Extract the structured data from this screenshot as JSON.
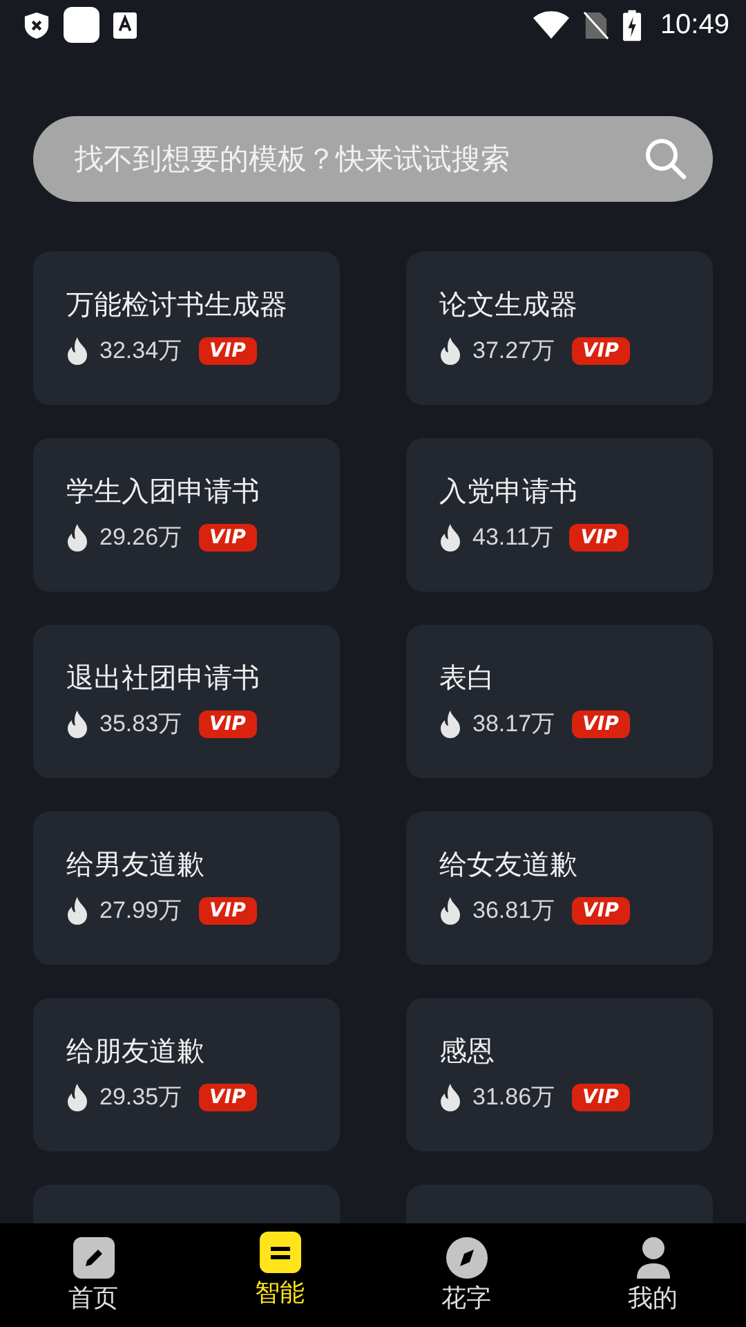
{
  "status_bar": {
    "time": "10:49"
  },
  "search": {
    "placeholder": "找不到想要的模板？快来试试搜索"
  },
  "templates": [
    {
      "kind": "template",
      "title": "万能检讨书生成器",
      "count": "32.34万",
      "badge": "VIP"
    },
    {
      "kind": "template",
      "title": "论文生成器",
      "count": "37.27万",
      "badge": "VIP"
    },
    {
      "kind": "template",
      "title": "学生入团申请书",
      "count": "29.26万",
      "badge": "VIP"
    },
    {
      "kind": "template",
      "title": "入党申请书",
      "count": "43.11万",
      "badge": "VIP"
    },
    {
      "kind": "template",
      "title": "退出社团申请书",
      "count": "35.83万",
      "badge": "VIP"
    },
    {
      "kind": "template",
      "title": "表白",
      "count": "38.17万",
      "badge": "VIP"
    },
    {
      "kind": "template",
      "title": "给男友道歉",
      "count": "27.99万",
      "badge": "VIP"
    },
    {
      "kind": "template",
      "title": "给女友道歉",
      "count": "36.81万",
      "badge": "VIP"
    },
    {
      "kind": "template",
      "title": "给朋友道歉",
      "count": "29.35万",
      "badge": "VIP"
    },
    {
      "kind": "template",
      "title": "感恩",
      "count": "31.86万",
      "badge": "VIP"
    },
    {
      "kind": "blank"
    },
    {
      "kind": "blank"
    }
  ],
  "bottom_nav": [
    {
      "kind": "pencil",
      "label": "首页",
      "selected": false
    },
    {
      "kind": "lines",
      "label": "智能",
      "selected": true
    },
    {
      "kind": "compass",
      "label": "花字",
      "selected": false
    },
    {
      "kind": "person",
      "label": "我的",
      "selected": false
    }
  ]
}
